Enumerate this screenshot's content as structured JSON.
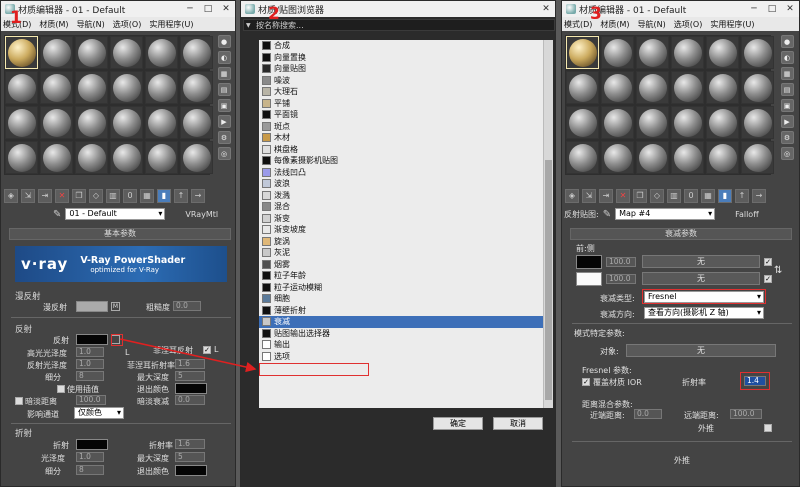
{
  "left_editor": {
    "title": "材质编辑器 - 01 - Default",
    "window_buttons": [
      "─",
      "□",
      "✕"
    ],
    "menu": [
      "模式(D)",
      "材质(M)",
      "导航(N)",
      "选项(O)",
      "实用程序(U)"
    ],
    "material_name": "01 - Default",
    "material_type": "VRayMtl",
    "rollout_basic": "基本参数",
    "banner": {
      "logo": "v·ray",
      "title": "V-Ray PowerShader",
      "subtitle": "optimized for V-Ray"
    },
    "diffuse_section": "漫反射",
    "diffuse_label": "漫反射",
    "diffuse_m": "M",
    "roughness_label": "粗糙度",
    "roughness_value": "0.0",
    "reflection_section": "反射",
    "reflect_label": "反射",
    "fresnel_label": "菲涅耳反射",
    "fresnel_l": "L",
    "hilight_gloss_label": "高光光泽度",
    "hilight_gloss_value": "1.0",
    "hilight_l": "L",
    "refl_gloss_label": "反射光泽度",
    "refl_gloss_value": "1.0",
    "fresnel_ior_label": "菲涅耳折射率",
    "fresnel_ior_value": "1.6",
    "subdivs_label": "细分",
    "subdivs_value": "8",
    "max_depth_label": "最大深度",
    "max_depth_value": "5",
    "use_interp_label": "使用插值",
    "exit_color_label": "退出颜色",
    "dim_dist_label": "暗淡距离",
    "dim_dist_value": "100.0",
    "dim_falloff_label": "暗淡衰减",
    "dim_falloff_value": "0.0",
    "affect_channels_label": "影响通道",
    "affect_channels_value": "仅颜色",
    "refraction_section": "折射",
    "refract_label": "折射",
    "ior_label": "折射率",
    "ior_value": "1.6",
    "gloss_label": "光泽度",
    "gloss_value": "1.0",
    "refr_max_depth_label": "最大深度",
    "refr_max_depth_value": "5",
    "refr_subdivs_label": "细分",
    "refr_subdivs_value": "8",
    "refr_exit_color_label": "退出颜色"
  },
  "browser": {
    "title": "材质/贴图浏览器",
    "window_buttons": [
      "✕"
    ],
    "search_placeholder": "按名称搜索...",
    "items": [
      {
        "label": "合成",
        "swatch": "#101010"
      },
      {
        "label": "向量置换",
        "swatch": "#101010"
      },
      {
        "label": "向量贴图",
        "swatch": "#2a2a2a"
      },
      {
        "label": "噪波",
        "swatch": "#8a8a8a"
      },
      {
        "label": "大理石",
        "swatch": "#b8b4a6"
      },
      {
        "label": "平铺",
        "swatch": "#c8b48a"
      },
      {
        "label": "平面镜",
        "swatch": "#101010"
      },
      {
        "label": "斑点",
        "swatch": "#9a9a9a"
      },
      {
        "label": "木材",
        "swatch": "#c89a48"
      },
      {
        "label": "棋盘格",
        "swatch": "#e0e0e0"
      },
      {
        "label": "每像素摄影机贴图",
        "swatch": "#101010"
      },
      {
        "label": "法线凹凸",
        "swatch": "#9a9aea"
      },
      {
        "label": "波浪",
        "swatch": "#c0c8d8"
      },
      {
        "label": "泼溅",
        "swatch": "#d8d8d8"
      },
      {
        "label": "混合",
        "swatch": "#888888"
      },
      {
        "label": "渐变",
        "swatch": "#d0d0d0"
      },
      {
        "label": "渐变坡度",
        "swatch": "#e8e8e8"
      },
      {
        "label": "旋涡",
        "swatch": "#e0b878"
      },
      {
        "label": "灰泥",
        "swatch": "#c8c8c8"
      },
      {
        "label": "烟雾",
        "swatch": "#505050"
      },
      {
        "label": "粒子年龄",
        "swatch": "#101010"
      },
      {
        "label": "粒子运动模糊",
        "swatch": "#101010"
      },
      {
        "label": "细胞",
        "swatch": "#5a7a9a"
      },
      {
        "label": "薄壁折射",
        "swatch": "#101010"
      },
      {
        "label": "衰减",
        "swatch": "#c8c8c8"
      },
      {
        "label": "贴图输出选择器",
        "swatch": "#101010"
      },
      {
        "label": "输出",
        "swatch": "#ffffff"
      },
      {
        "label": "选项",
        "swatch": "#ffffff"
      }
    ],
    "selected_index": 24,
    "ok_label": "确定",
    "cancel_label": "取消"
  },
  "right_editor": {
    "title": "材质编辑器 - 01 - Default",
    "window_buttons": [
      "─",
      "□",
      "✕"
    ],
    "menu": [
      "模式(D)",
      "材质(M)",
      "导航(N)",
      "选项(O)",
      "实用程序(U)"
    ],
    "map_label": "反射贴图:",
    "map_name": "Map #4",
    "map_type": "Falloff",
    "rollout_falloff": "衰减参数",
    "front_side_label": "前:侧",
    "front_value": "100.0",
    "front_map": "无",
    "side_value": "100.0",
    "side_map": "无",
    "falloff_type_label": "衰减类型:",
    "falloff_type_value": "Fresnel",
    "falloff_dir_label": "衰减方向:",
    "falloff_dir_value": "查看方向(摄影机 Z 轴)",
    "mode_params_label": "模式特定参数:",
    "object_label": "对象:",
    "object_value": "无",
    "fresnel_params_label": "Fresnel 参数:",
    "override_ior_label": "覆盖材质 IOR",
    "ior_label": "折射率",
    "ior_value": "1.4",
    "dist_blend_label": "距离混合参数:",
    "near_label": "近端距离:",
    "near_value": "0.0",
    "far_label": "远端距离:",
    "far_value": "100.0",
    "extrapolate_label": "外推",
    "extrapolate2_label": "外推"
  },
  "markers": [
    "1",
    "2",
    "3"
  ]
}
